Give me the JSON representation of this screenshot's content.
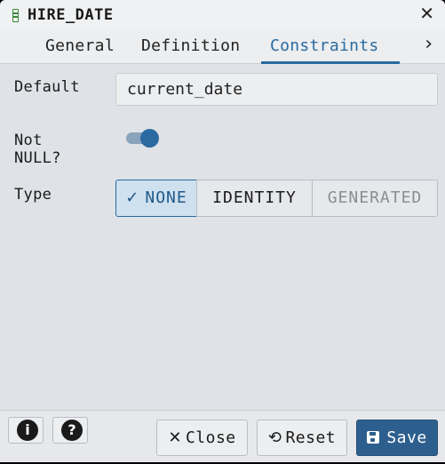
{
  "window": {
    "title": "HIRE_DATE",
    "title_icon": "column-icon",
    "close_glyph": "✕"
  },
  "tabs": {
    "items": [
      {
        "label": "General"
      },
      {
        "label": "Definition"
      },
      {
        "label": "Constraints"
      }
    ],
    "active": "Constraints",
    "more_glyph": "›"
  },
  "form": {
    "default": {
      "label": "Default",
      "value": "current_date"
    },
    "not_null": {
      "label": "Not NULL?",
      "checked": true
    },
    "type": {
      "label": "Type",
      "options": [
        "NONE",
        "IDENTITY",
        "GENERATED"
      ],
      "selected": "NONE",
      "check_glyph": "✓"
    }
  },
  "footer": {
    "info_glyph": "i",
    "help_glyph": "?",
    "close_label": "Close",
    "close_glyph": "✕",
    "reset_label": "Reset",
    "reset_glyph": "⟲",
    "save_label": "Save"
  },
  "colors": {
    "accent": "#2a6aa0",
    "primary_button": "#2d5f8e",
    "background": "#dfe2e6"
  }
}
